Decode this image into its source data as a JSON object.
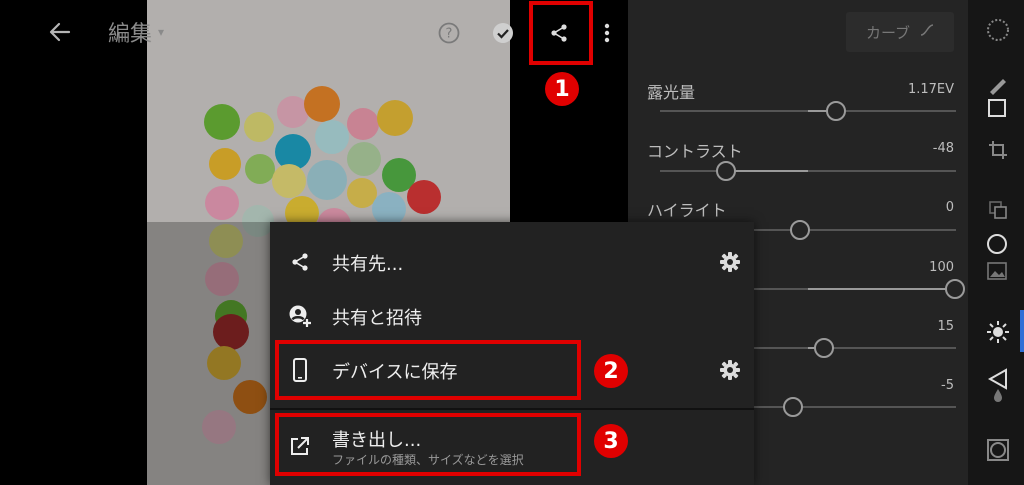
{
  "header": {
    "title": "編集"
  },
  "panel": {
    "curve_label": "カーブ",
    "adjustments": [
      {
        "label": "露光量",
        "value": "1.17EV"
      },
      {
        "label": "コントラスト",
        "value": "-48"
      },
      {
        "label": "ハイライト",
        "value": "0"
      },
      {
        "label": "",
        "value": "100"
      },
      {
        "label": "",
        "value": "15"
      },
      {
        "label": "",
        "value": "-5"
      }
    ]
  },
  "share_menu": {
    "items": [
      {
        "label": "共有先...",
        "icon": "share-icon",
        "has_settings": true
      },
      {
        "label": "共有と招待",
        "icon": "add-person-icon",
        "has_settings": false
      },
      {
        "label": "デバイスに保存",
        "icon": "phone-icon",
        "has_settings": true
      },
      {
        "label": "書き出し...",
        "sublabel": "ファイルの種類、サイズなどを選択",
        "icon": "export-icon",
        "has_settings": false
      }
    ]
  },
  "annotations": {
    "badges": [
      "1",
      "2",
      "3"
    ],
    "highlight_color": "#e00000"
  },
  "colors": {
    "panel_bg": "#242424",
    "rail_bg": "#161616",
    "menu_bg": "#222222",
    "accent_blue": "#2f6fd6"
  }
}
